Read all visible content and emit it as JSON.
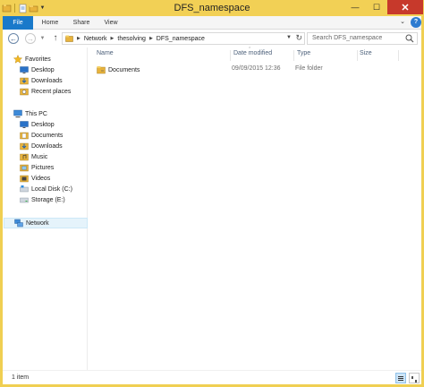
{
  "window": {
    "title": "DFS_namespace",
    "controls": {
      "minimize": "—",
      "maximize": "☐",
      "close": "✕"
    },
    "accent": "#f2d055",
    "close_color": "#c7392b"
  },
  "ribbon": {
    "tabs": [
      {
        "label": "File",
        "active": true,
        "color": "#1979ca"
      },
      {
        "label": "Home"
      },
      {
        "label": "Share"
      },
      {
        "label": "View"
      }
    ],
    "help": "?"
  },
  "address": {
    "crumbs": [
      "Network",
      "thesolving",
      "DFS_namespace"
    ],
    "search_placeholder": "Search DFS_namespace"
  },
  "nav": {
    "favorites_label": "Favorites",
    "favorites": [
      "Desktop",
      "Downloads",
      "Recent places"
    ],
    "pc_label": "This PC",
    "pc_items": [
      "Desktop",
      "Documents",
      "Downloads",
      "Music",
      "Pictures",
      "Videos",
      "Local Disk (C:)",
      "Storage (E:)"
    ],
    "network_label": "Network"
  },
  "columns": [
    "Name",
    "Date modified",
    "Type",
    "Size"
  ],
  "files": [
    {
      "name": "Documents",
      "date": "09/09/2015 12:36",
      "type": "File folder",
      "size": ""
    }
  ],
  "status": {
    "count": "1 item"
  }
}
